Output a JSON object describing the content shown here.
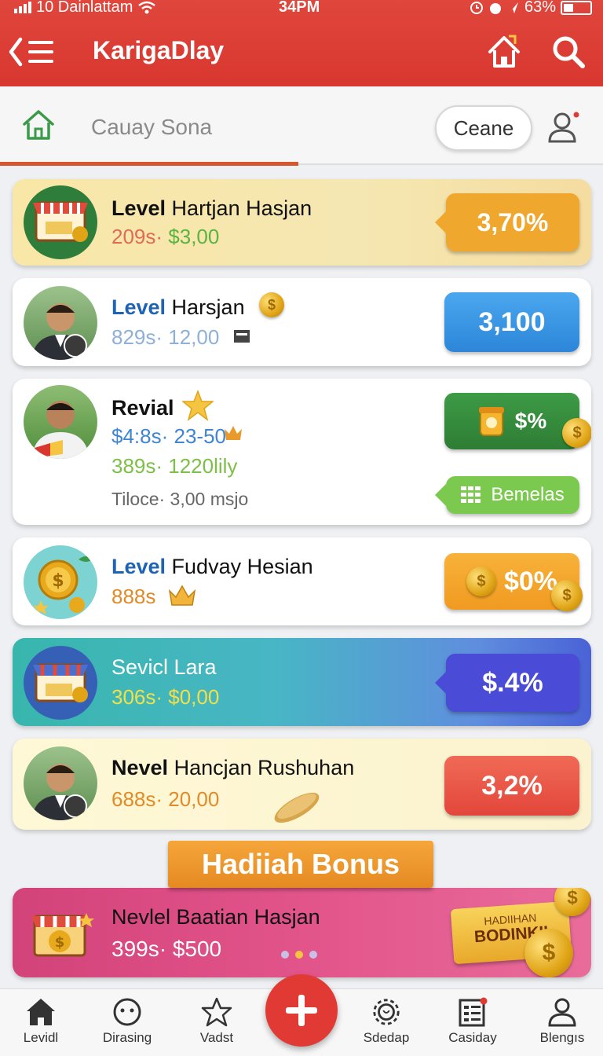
{
  "status_bar": {
    "carrier": "10 Dainlattam",
    "time": "34PM",
    "battery": "63%"
  },
  "header": {
    "title": "KarigaDlay"
  },
  "search": {
    "name": "Cauay Sona",
    "clear_label": "Ceane"
  },
  "cards": [
    {
      "title_bold": "Level",
      "title_rest": " Hartjan Hasjan",
      "line1a": "209s·",
      "line1b": " $3,00",
      "badge": "3,70%"
    },
    {
      "title_bold": "Level",
      "title_rest": " Harsjan",
      "line1": "829s· 12,00",
      "badge": "3,100"
    },
    {
      "title": "Revial",
      "line1": "$4:8s· 23-50",
      "line2": "389s· 1220lily",
      "line3": "Tiloce· 3,00 msjo",
      "badge1": "$%",
      "badge2": "Bemelas"
    },
    {
      "title_bold": "Level",
      "title_rest": " Fudvay Hesian",
      "line1": "888s",
      "badge": "$0%"
    },
    {
      "title": "Sevicl Lara",
      "line1": "306s· $0,00",
      "badge": "$.4%"
    },
    {
      "title_bold": "Nevel",
      "title_rest": " Hancjan Rushuhan",
      "line1": "688s· 20,00",
      "badge": "3,2%"
    }
  ],
  "bonus": {
    "ribbon": "Hadiiah Bonus",
    "title": "Nevlel Baatian Hasjan",
    "line1": "399s· $500",
    "sign_line1": "HADIIHAN",
    "sign_line2": "BODINKII"
  },
  "bottom_nav": [
    {
      "label": "Levidl",
      "icon": "home-icon"
    },
    {
      "label": "Dirasing",
      "icon": "smile-icon"
    },
    {
      "label": "Vadst",
      "icon": "star-icon"
    },
    {
      "label": "Sdedap",
      "icon": "gear-icon"
    },
    {
      "label": "Casiday",
      "icon": "list-icon"
    },
    {
      "label": "Blengıs",
      "icon": "user-icon"
    }
  ],
  "colors": {
    "header_red": "#d8372f",
    "badge_orange": "#f0a72e",
    "badge_blue": "#2f8fe0",
    "badge_green": "#2e8b3a",
    "badge_lightgreen": "#7bc94f",
    "badge_indigo": "#4a4bd6",
    "badge_red": "#e85546",
    "bonus_pink": "#d2437a"
  }
}
